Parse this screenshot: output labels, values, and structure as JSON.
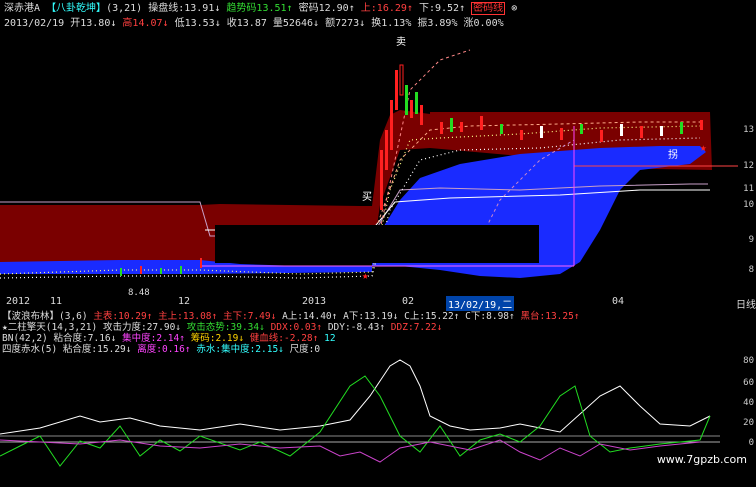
{
  "header": {
    "line1": {
      "stock": "深赤港A",
      "indicator": "【八卦乾坤】",
      "params": "(3,21)",
      "fields": [
        {
          "label": "操盘线:",
          "value": "13.91",
          "arrow": "↓",
          "color": "w"
        },
        {
          "label": "趋势码",
          "value": "13.51",
          "arrow": "↑",
          "color": "g"
        },
        {
          "label": "密码",
          "value": "12.90",
          "arrow": "↑",
          "color": "w"
        },
        {
          "label": "上:",
          "value": "16.29",
          "arrow": "↑",
          "color": "r"
        },
        {
          "label": "下:",
          "value": "9.52",
          "arrow": "↑",
          "color": "w"
        }
      ],
      "badge": "密码线"
    },
    "line2": {
      "date": "2013/02/19",
      "fields": [
        {
          "label": "开",
          "value": "13.80",
          "arrow": "↓",
          "color": "w"
        },
        {
          "label": "高",
          "value": "14.07",
          "arrow": "↓",
          "color": "r"
        },
        {
          "label": "低",
          "value": "13.53",
          "arrow": "↓",
          "color": "w"
        },
        {
          "label": "收",
          "value": "13.87",
          "arrow": "",
          "color": "w"
        },
        {
          "label": "量",
          "value": "52646",
          "arrow": "↓",
          "color": "w"
        },
        {
          "label": "额",
          "value": "7273",
          "arrow": "↓",
          "color": "w"
        },
        {
          "label": "换",
          "value": "1.13%",
          "arrow": "",
          "color": "w"
        },
        {
          "label": "振",
          "value": "3.89%",
          "arrow": "",
          "color": "w"
        },
        {
          "label": "涨",
          "value": "0.00%",
          "arrow": "",
          "color": "w"
        }
      ]
    }
  },
  "chart_labels": {
    "buy": "买",
    "sell": "卖",
    "sell2": "拐",
    "low_price": "8.48"
  },
  "price_axis": [
    "13",
    "12",
    "11",
    "10",
    "9",
    "8"
  ],
  "xaxis": {
    "labels": [
      "2012",
      "11",
      "12",
      "2013",
      "02",
      "04",
      "日线"
    ],
    "cursor": "13/02/19,二"
  },
  "indicators": {
    "line1": {
      "name": "【波浪布林】",
      "params": "(3,6)",
      "fields": [
        {
          "label": "主表:",
          "value": "10.29",
          "arrow": "↑",
          "color": "r"
        },
        {
          "label": "主上:",
          "value": "13.08",
          "arrow": "↑",
          "color": "r"
        },
        {
          "label": "主下:",
          "value": "7.49",
          "arrow": "↓",
          "color": "r"
        },
        {
          "label": "A上:",
          "value": "14.40",
          "arrow": "↑",
          "color": "w"
        },
        {
          "label": "A下:",
          "value": "13.19",
          "arrow": "↓",
          "color": "w"
        },
        {
          "label": "C上:",
          "value": "15.22",
          "arrow": "↑",
          "color": "w"
        },
        {
          "label": "C下:",
          "value": "8.98",
          "arrow": "↑",
          "color": "w"
        },
        {
          "label": "黑台:",
          "value": "13.25",
          "arrow": "↑",
          "color": "r"
        }
      ]
    },
    "line2": {
      "name": "★二柱擎天",
      "params": "(14,3,21)",
      "fields": [
        {
          "label": "攻击力度:",
          "value": "27.90",
          "arrow": "↓",
          "color": "w"
        },
        {
          "label": "攻击态势:",
          "value": "39.34",
          "arrow": "↓",
          "color": "g"
        },
        {
          "label": "DDX:",
          "value": "0.03",
          "arrow": "↑",
          "color": "r"
        },
        {
          "label": "DDY:",
          "value": "-8.43",
          "arrow": "↑",
          "color": "w"
        },
        {
          "label": "DDZ:",
          "value": "7.22",
          "arrow": "↓",
          "color": "r"
        }
      ]
    },
    "line3": {
      "name": "BN",
      "params": "(42,2)",
      "fields": [
        {
          "label": "粘合度:",
          "value": "7.16",
          "arrow": "↓",
          "color": "w"
        },
        {
          "label": "集中度:",
          "value": "2.14",
          "arrow": "↑",
          "color": "m"
        },
        {
          "label": "筹码:",
          "value": "2.19",
          "arrow": "↓",
          "color": "y"
        },
        {
          "label": "健血线:",
          "value": "-2.28",
          "arrow": "↑",
          "color": "r"
        },
        {
          "label": "",
          "value": "12",
          "arrow": "",
          "color": "c"
        }
      ]
    },
    "line4": {
      "name": "四度赤水",
      "params": "(5)",
      "fields": [
        {
          "label": "粘合度:",
          "value": "15.29",
          "arrow": "↓",
          "color": "w"
        },
        {
          "label": "离度:",
          "value": "0.16",
          "arrow": "↑",
          "color": "m"
        },
        {
          "label": "赤水:",
          "value": "集中度:2.15",
          "arrow": "↓",
          "color": "c"
        },
        {
          "label": "尺度:",
          "value": "0",
          "arrow": "",
          "color": "w"
        }
      ]
    }
  },
  "lower_axis": [
    "80",
    "60",
    "40",
    "20",
    "0"
  ],
  "watermark": "www.7gpzb.com",
  "colors": {
    "bg": "#000000",
    "band": "#8b0000",
    "blue": "#1a2bff",
    "red": "#ff2020",
    "green": "#22dd22"
  }
}
